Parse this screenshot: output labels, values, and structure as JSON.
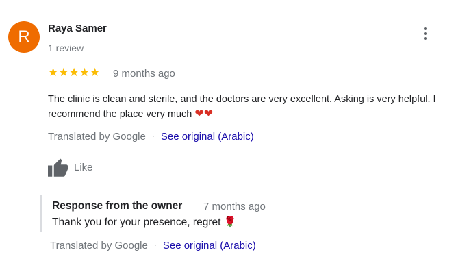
{
  "review": {
    "avatar_letter": "R",
    "avatar_color": "#ef6c00",
    "reviewer_name": "Raya Samer",
    "review_count": "1 review",
    "rating": 5,
    "stars_text": "★★★★★",
    "time": "9 months ago",
    "text": "The clinic is clean and sterile, and the doctors are very excellent. Asking is very helpful. I recommend the place very much",
    "emoji_icons": [
      "heart-icon",
      "heart-icon"
    ],
    "translated_label": "Translated by Google",
    "separator": "·",
    "see_original": "See original (Arabic)",
    "like_label": "Like",
    "more_icon": "more-vert-icon"
  },
  "owner_response": {
    "title": "Response from the owner",
    "time": "7 months ago",
    "text": "Thank you for your presence, regret",
    "emoji_icon": "rose-icon",
    "translated_label": "Translated by Google",
    "separator": "·",
    "see_original": "See original (Arabic)"
  },
  "colors": {
    "star": "#fbbc04",
    "link": "#1a0dab",
    "secondary_text": "#70757a",
    "primary_text": "#202124"
  }
}
